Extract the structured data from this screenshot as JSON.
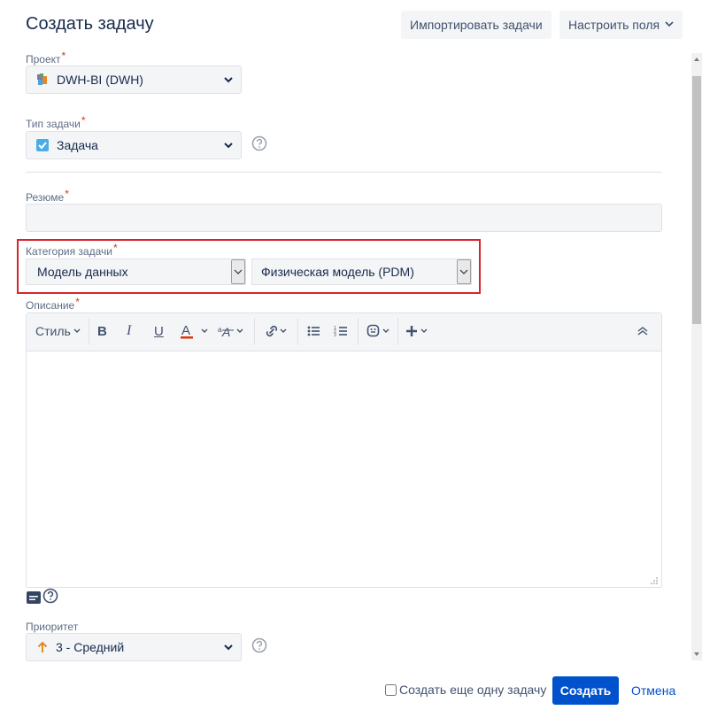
{
  "dialog": {
    "title": "Создать задачу",
    "import_button": "Импортировать задачи",
    "configure_button": "Настроить поля"
  },
  "fields": {
    "project": {
      "label": "Проект",
      "value": "DWH-BI (DWH)"
    },
    "issue_type": {
      "label": "Тип задачи",
      "value": "Задача"
    },
    "summary": {
      "label": "Резюме",
      "value": ""
    },
    "category": {
      "label": "Категория задачи",
      "value1": "Модель данных",
      "value2": "Физическая модель (PDM)"
    },
    "description": {
      "label": "Описание"
    },
    "priority": {
      "label": "Приоритет",
      "value": "3 - Средний"
    }
  },
  "toolbar": {
    "style_label": "Стиль"
  },
  "footer": {
    "create_another_label": "Создать еще одну задачу",
    "create_button": "Создать",
    "cancel_link": "Отмена"
  },
  "colors": {
    "primary": "#0052cc",
    "highlight_border": "#d9242b",
    "required": "#de350b",
    "priority_arrow": "#e2892c",
    "checkbox_blue": "#2684ff"
  },
  "icons": {
    "project": "project-avatar-icon",
    "issue_type": "task-checkbox-icon",
    "priority": "priority-medium-icon"
  }
}
